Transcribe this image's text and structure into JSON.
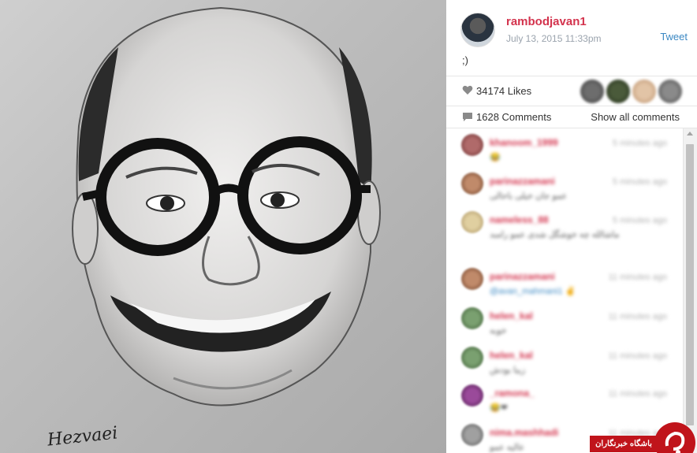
{
  "post": {
    "username": "rambodjavan1",
    "date": "July 13, 2015 11:33pm",
    "tweet_label": "Tweet",
    "caption": ";)",
    "likes_label": "34174 Likes",
    "comments_label": "1628 Comments",
    "show_all_label": "Show all comments"
  },
  "artwork": {
    "signature": "Hezvaei"
  },
  "comments": [
    {
      "user": "khanoom_1999",
      "time": "5 minutes ago",
      "text": "😂"
    },
    {
      "user": "parinazzamani",
      "time": "5 minutes ago",
      "text": "عمو جان خیلی باحالی"
    },
    {
      "user": "nameless_88",
      "time": "5 minutes ago",
      "text": "ماشالله چه خوشگل شدی عمو رامبد"
    },
    {
      "user": "parinazzamani",
      "time": "11 minutes ago",
      "text": "@avan_mahmani1 ✌"
    },
    {
      "user": "helen_kal",
      "time": "11 minutes ago",
      "text": "خوبه"
    },
    {
      "user": "helen_kal",
      "time": "11 minutes ago",
      "text": "زیبا بودش"
    },
    {
      "user": "_ramona_",
      "time": "11 minutes ago",
      "text": "😂❤"
    },
    {
      "user": "nima.mashhadi",
      "time": "11 minutes ago",
      "text": "عالیه عمو"
    }
  ],
  "watermark": {
    "label": "باشگاه خبرنگاران"
  },
  "colors": {
    "username": "#d3334d",
    "link": "#3b88c3",
    "watermark": "#c0141b"
  },
  "icons": [
    "heart-icon",
    "comment-icon",
    "scroll-up-icon"
  ]
}
